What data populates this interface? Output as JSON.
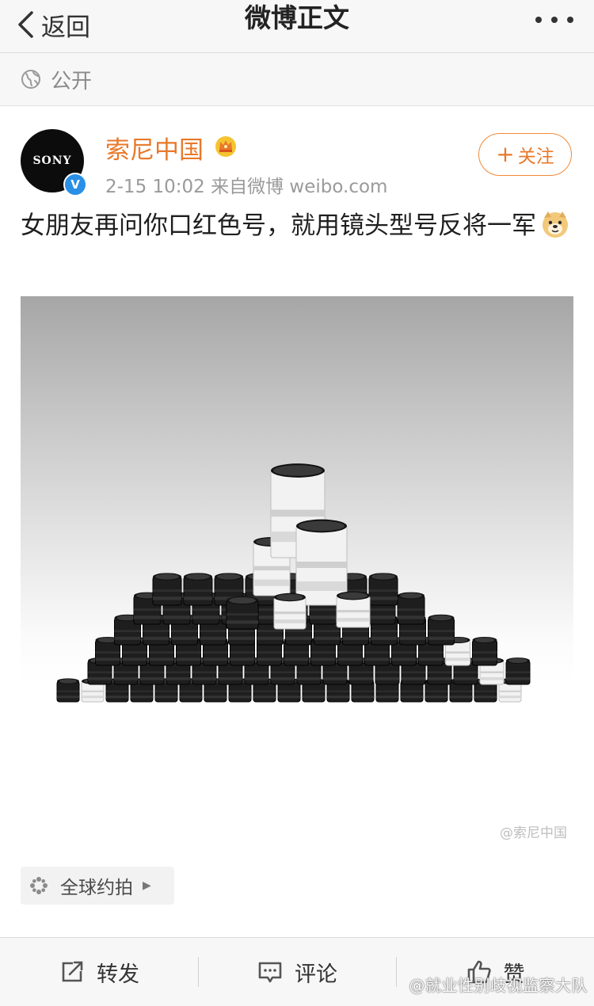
{
  "nav": {
    "back_label": "返回",
    "title": "微博正文",
    "more_icon": "ellipsis-icon"
  },
  "visibility": {
    "icon": "globe-icon",
    "label": "公开"
  },
  "post": {
    "user": {
      "name": "索尼中国",
      "avatar_text": "SONY",
      "verified_mark": "V",
      "badge_icon": "crown-icon"
    },
    "meta": "2-15 10:02  来自微博 weibo.com",
    "follow": {
      "plus": "+",
      "label": "关注"
    },
    "text": "女朋友再问你口红色号，就用镜头型号反将一军",
    "emoji_icon": "doge-emoji-icon",
    "image": {
      "alt_subject": "lens-collection-photo",
      "watermark": "@索尼中国"
    },
    "location_tag": {
      "icon": "location-pin-icon",
      "label": "全球约拍"
    }
  },
  "toolbar": {
    "repost_label": "转发",
    "comment_label": "评论",
    "like_label": "赞"
  },
  "footer_watermark": "@就业性别歧视监察大队",
  "colors": {
    "accent": "#e8792b",
    "verified": "#2a8fe6",
    "bar_bg": "#f7f7f7"
  }
}
